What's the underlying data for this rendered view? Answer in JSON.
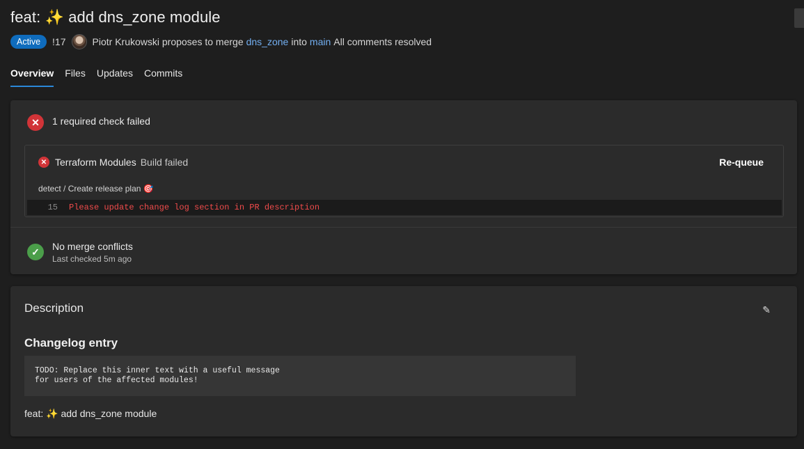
{
  "pr": {
    "title": "feat: ✨ add dns_zone module",
    "status": "Active",
    "number": "!17",
    "author_text": "Piotr Krukowski proposes to merge",
    "source_branch": "dns_zone",
    "into": "into",
    "target_branch": "main",
    "comments_status": "All comments resolved"
  },
  "tabs": [
    "Overview",
    "Files",
    "Updates",
    "Commits"
  ],
  "checks": {
    "summary": "1 required check failed",
    "build": {
      "name": "Terraform Modules",
      "status": "Build failed",
      "action": "Re-queue",
      "step": "detect / Create release plan 🎯",
      "log_line_number": "15",
      "log_message": "Please update change log section in PR description"
    },
    "merge": {
      "title": "No merge conflicts",
      "subtitle": "Last checked 5m ago"
    }
  },
  "description": {
    "heading": "Description",
    "changelog_heading": "Changelog entry",
    "code_line1": "TODO: Replace this inner text with a useful message",
    "code_line2": "for users of the affected modules!",
    "body": "feat: ✨ add dns_zone module"
  },
  "icons": {
    "error": "error-circle-icon",
    "success": "check-circle-icon",
    "edit": "pencil-icon"
  },
  "colors": {
    "accent": "#0f6cbd",
    "link": "#72aef0",
    "error": "#d13438",
    "success": "#4b9e4a",
    "log_error": "#f04b4b"
  }
}
